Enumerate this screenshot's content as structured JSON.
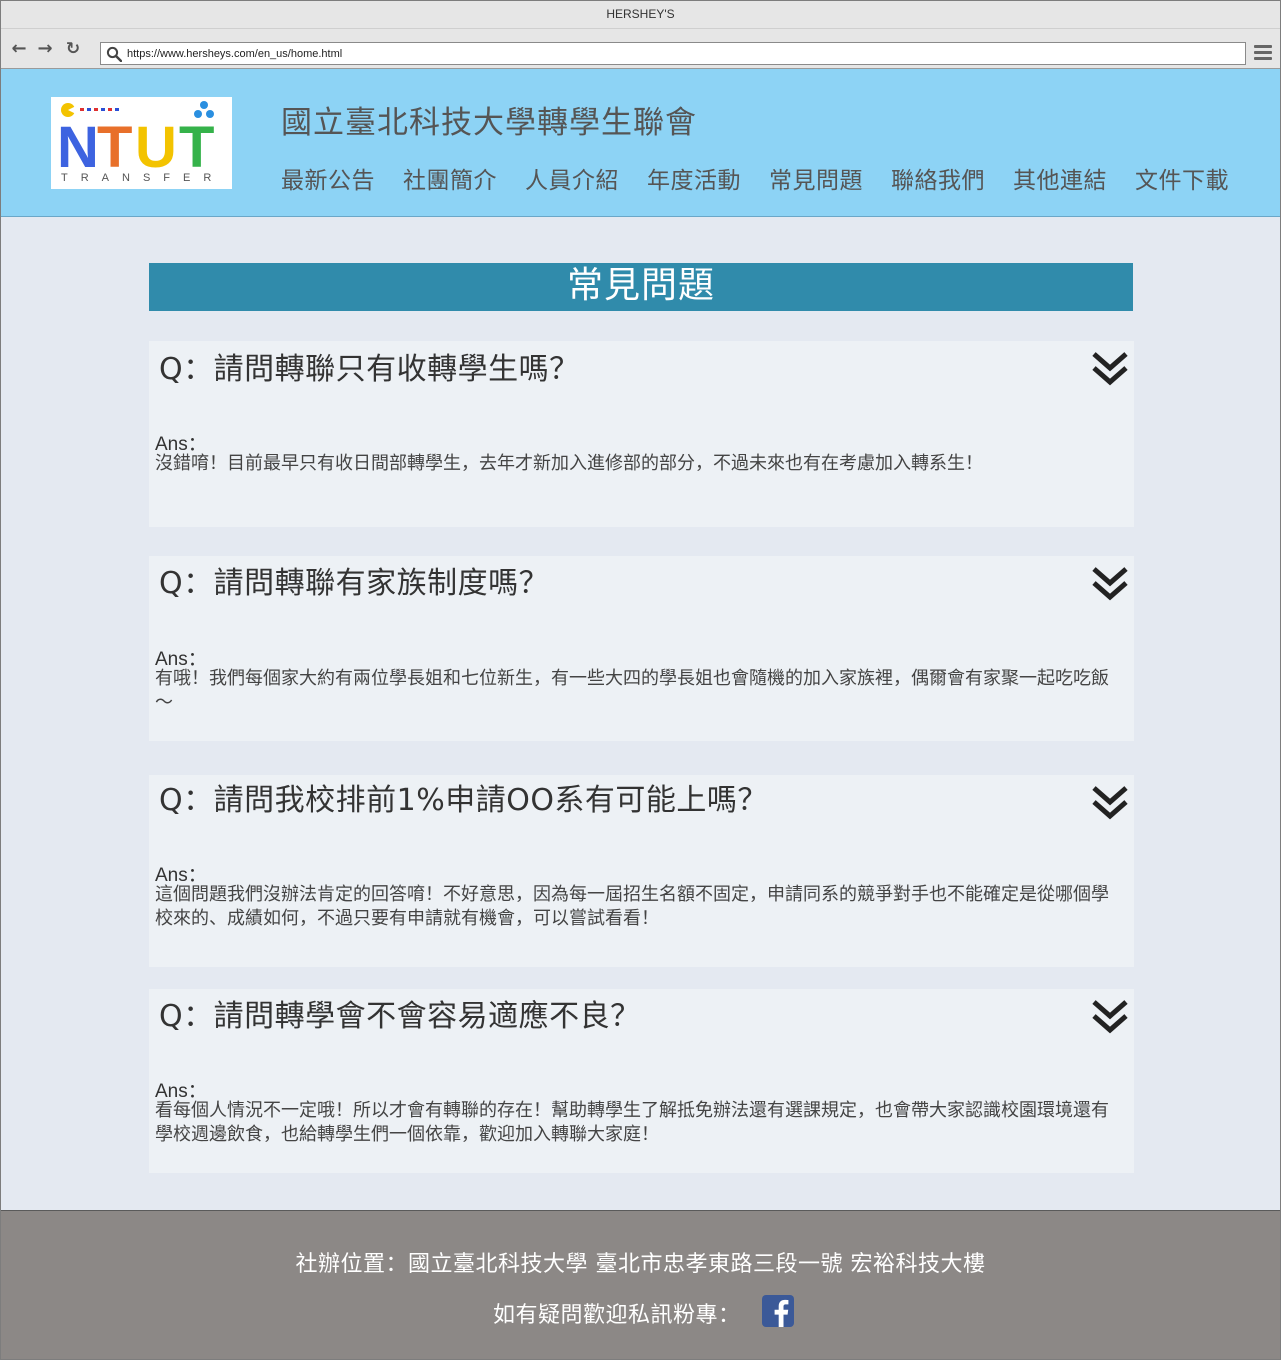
{
  "browser": {
    "window_title": "HERSHEY'S",
    "url": "https://www.hersheys.com/en_us/home.html",
    "back_icon": "arrow-left-icon",
    "forward_icon": "arrow-right-icon",
    "reload_icon": "reload-icon",
    "menu_icon": "hamburger-menu-icon"
  },
  "header": {
    "logo_text": "NTUT",
    "logo_subtext": "TRANSFER",
    "site_title": "國立臺北科技大學轉學生聯會",
    "nav": [
      {
        "label": "最新公告"
      },
      {
        "label": "社團簡介"
      },
      {
        "label": "人員介紹"
      },
      {
        "label": "年度活動"
      },
      {
        "label": "常見問題"
      },
      {
        "label": "聯絡我們"
      },
      {
        "label": "其他連結"
      },
      {
        "label": "文件下載"
      }
    ],
    "bg_color": "#8dd3f5"
  },
  "main": {
    "section_title": "常見問題",
    "section_color": "#308bab",
    "faqs": [
      {
        "question": "Q：請問轉聯只有收轉學生嗎？",
        "answer_label": "Ans：",
        "answer": "沒錯唷！目前最早只有收日間部轉學生，去年才新加入進修部的部分，不過未來也有在考慮加入轉系生！"
      },
      {
        "question": "Q：請問轉聯有家族制度嗎？",
        "answer_label": "Ans：",
        "answer": "有哦！我們每個家大約有兩位學長姐和七位新生，有一些大四的學長姐也會隨機的加入家族裡，偶爾會有家聚一起吃吃飯～"
      },
      {
        "question": "Q：請問我校排前1%申請OO系有可能上嗎？",
        "answer_label": "Ans：",
        "answer": "這個問題我們沒辦法肯定的回答唷！不好意思，因為每一屆招生名額不固定，申請同系的競爭對手也不能確定是從哪個學校來的、成績如何，不過只要有申請就有機會，可以嘗試看看！"
      },
      {
        "question": "Q：請問轉學會不會容易適應不良？",
        "answer_label": "Ans：",
        "answer": "看每個人情況不一定哦！所以才會有轉聯的存在！幫助轉學生了解抵免辦法還有選課規定，也會帶大家認識校園環境還有學校週邊飲食，也給轉學生們一個依靠，歡迎加入轉聯大家庭！"
      }
    ],
    "expand_icon": "double-chevron-down-icon"
  },
  "footer": {
    "address": "社辦位置：國立臺北科技大學  臺北市忠孝東路三段一號  宏裕科技大樓",
    "contact": "如有疑問歡迎私訊粉專：",
    "fb_icon": "facebook-icon",
    "bg_color": "#8c8886"
  }
}
